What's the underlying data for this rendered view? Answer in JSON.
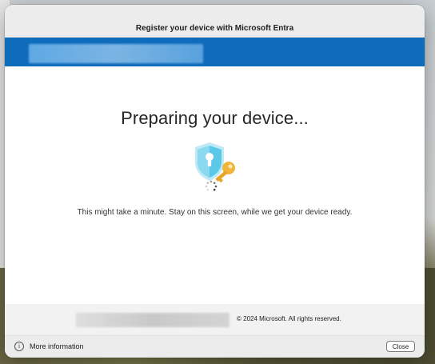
{
  "window": {
    "title": "Register your device with Microsoft Entra"
  },
  "main": {
    "heading": "Preparing your device...",
    "message": "This might take a minute. Stay on this screen, while we get your device ready.",
    "illustration_icons": [
      "shield-lock-icon",
      "key-icon",
      "spinner-icon"
    ]
  },
  "footer": {
    "copyright": "© 2024 Microsoft. All rights reserved."
  },
  "bottom_bar": {
    "info_label": "More information",
    "info_icon_glyph": "i",
    "close_label": "Close"
  },
  "colors": {
    "accent_bar": "#0f6cbd",
    "shield": "#5cc8e8",
    "key": "#f0b63c"
  }
}
